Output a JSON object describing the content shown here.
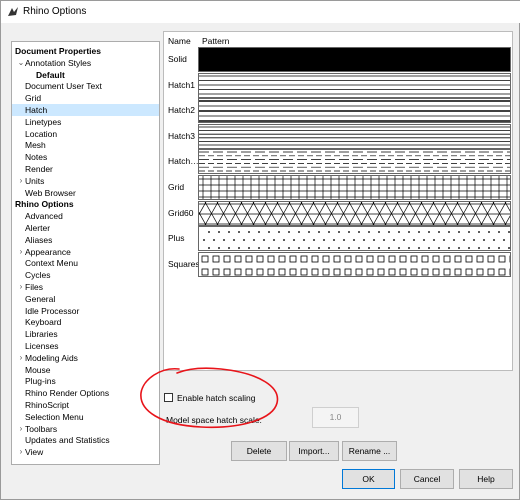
{
  "window": {
    "title": "Rhino Options"
  },
  "tree": {
    "items": [
      {
        "label": "Document Properties",
        "level": 0,
        "bold": true,
        "arrow": ""
      },
      {
        "label": "Annotation Styles",
        "level": 1,
        "bold": false,
        "arrow": "⌄"
      },
      {
        "label": "Default",
        "level": 2,
        "bold": true,
        "arrow": ""
      },
      {
        "label": "Document User Text",
        "level": 1,
        "bold": false,
        "arrow": ""
      },
      {
        "label": "Grid",
        "level": 1,
        "bold": false,
        "arrow": ""
      },
      {
        "label": "Hatch",
        "level": 1,
        "bold": false,
        "arrow": "",
        "selected": true
      },
      {
        "label": "Linetypes",
        "level": 1,
        "bold": false,
        "arrow": ""
      },
      {
        "label": "Location",
        "level": 1,
        "bold": false,
        "arrow": ""
      },
      {
        "label": "Mesh",
        "level": 1,
        "bold": false,
        "arrow": ""
      },
      {
        "label": "Notes",
        "level": 1,
        "bold": false,
        "arrow": ""
      },
      {
        "label": "Render",
        "level": 1,
        "bold": false,
        "arrow": ""
      },
      {
        "label": "Units",
        "level": 1,
        "bold": false,
        "arrow": "›"
      },
      {
        "label": "Web Browser",
        "level": 1,
        "bold": false,
        "arrow": ""
      },
      {
        "label": "Rhino Options",
        "level": 0,
        "bold": true,
        "arrow": ""
      },
      {
        "label": "Advanced",
        "level": 1,
        "bold": false,
        "arrow": ""
      },
      {
        "label": "Alerter",
        "level": 1,
        "bold": false,
        "arrow": ""
      },
      {
        "label": "Aliases",
        "level": 1,
        "bold": false,
        "arrow": ""
      },
      {
        "label": "Appearance",
        "level": 1,
        "bold": false,
        "arrow": "›"
      },
      {
        "label": "Context Menu",
        "level": 1,
        "bold": false,
        "arrow": ""
      },
      {
        "label": "Cycles",
        "level": 1,
        "bold": false,
        "arrow": ""
      },
      {
        "label": "Files",
        "level": 1,
        "bold": false,
        "arrow": "›"
      },
      {
        "label": "General",
        "level": 1,
        "bold": false,
        "arrow": ""
      },
      {
        "label": "Idle Processor",
        "level": 1,
        "bold": false,
        "arrow": ""
      },
      {
        "label": "Keyboard",
        "level": 1,
        "bold": false,
        "arrow": ""
      },
      {
        "label": "Libraries",
        "level": 1,
        "bold": false,
        "arrow": ""
      },
      {
        "label": "Licenses",
        "level": 1,
        "bold": false,
        "arrow": ""
      },
      {
        "label": "Modeling Aids",
        "level": 1,
        "bold": false,
        "arrow": "›"
      },
      {
        "label": "Mouse",
        "level": 1,
        "bold": false,
        "arrow": ""
      },
      {
        "label": "Plug-ins",
        "level": 1,
        "bold": false,
        "arrow": ""
      },
      {
        "label": "Rhino Render Options",
        "level": 1,
        "bold": false,
        "arrow": ""
      },
      {
        "label": "RhinoScript",
        "level": 1,
        "bold": false,
        "arrow": ""
      },
      {
        "label": "Selection Menu",
        "level": 1,
        "bold": false,
        "arrow": ""
      },
      {
        "label": "Toolbars",
        "level": 1,
        "bold": false,
        "arrow": "›"
      },
      {
        "label": "Updates and Statistics",
        "level": 1,
        "bold": false,
        "arrow": ""
      },
      {
        "label": "View",
        "level": 1,
        "bold": false,
        "arrow": "›"
      }
    ]
  },
  "hatch_table": {
    "col_name": "Name",
    "col_pattern": "Pattern",
    "rows": [
      {
        "name": "Solid",
        "pattern": "solid"
      },
      {
        "name": "Hatch1",
        "pattern": "hatch1"
      },
      {
        "name": "Hatch2",
        "pattern": "hatch2"
      },
      {
        "name": "Hatch3",
        "pattern": "hatch3"
      },
      {
        "name": "Hatch…",
        "pattern": "dashes"
      },
      {
        "name": "Grid",
        "pattern": "grid"
      },
      {
        "name": "Grid60",
        "pattern": "grid60"
      },
      {
        "name": "Plus",
        "pattern": "plus"
      },
      {
        "name": "Squares",
        "pattern": "squares"
      }
    ]
  },
  "settings": {
    "enable_scaling_label": "Enable hatch scaling",
    "enable_scaling_checked": false,
    "model_scale_label": "Model space hatch scale:",
    "model_scale_value": "1.0"
  },
  "buttons": {
    "delete": "Delete",
    "import": "Import...",
    "rename": "Rename ...",
    "ok": "OK",
    "cancel": "Cancel",
    "help": "Help"
  },
  "colors": {
    "selection": "#cce8ff",
    "annotation_circle": "#e8141a",
    "default_button_border": "#0078d7"
  }
}
